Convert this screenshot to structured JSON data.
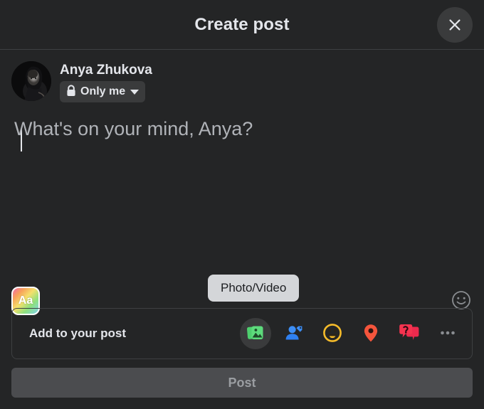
{
  "header": {
    "title": "Create post",
    "close_icon": "close-icon"
  },
  "author": {
    "name": "Anya Zhukova",
    "avatar_alt": "avatar",
    "privacy": {
      "label": "Only me",
      "lock_icon": "lock-icon",
      "chevron_icon": "chevron-down-icon"
    }
  },
  "composer": {
    "placeholder": "What's on your mind, Anya?",
    "value": ""
  },
  "tools": {
    "background_button_label": "Aa",
    "emoji_icon": "smiley-face-icon"
  },
  "add_to_post": {
    "label": "Add to your post",
    "tooltip": "Photo/Video",
    "items": [
      {
        "name": "photo-video",
        "icon": "photo-video-icon",
        "color": "#45bd62",
        "hovered": true
      },
      {
        "name": "tag-people",
        "icon": "tag-people-icon",
        "color": "#1877f2",
        "hovered": false
      },
      {
        "name": "feeling-activity",
        "icon": "feeling-activity-icon",
        "color": "#f7b928",
        "hovered": false
      },
      {
        "name": "check-in",
        "icon": "location-pin-icon",
        "color": "#f5533d",
        "hovered": false
      },
      {
        "name": "ask-for-recommendations",
        "icon": "question-speech-bubble-icon",
        "color": "#f0284a",
        "hovered": false
      },
      {
        "name": "more-options",
        "icon": "ellipsis-icon",
        "color": "#8a8d91",
        "hovered": false
      }
    ]
  },
  "footer": {
    "post_label": "Post",
    "post_enabled": false
  },
  "colors": {
    "dialog_bg": "#242526",
    "page_bg": "#18191a",
    "divider": "#3e4042",
    "text_primary": "#e4e6eb",
    "text_secondary": "#b0b3b8",
    "pill_bg": "#3a3b3c",
    "post_disabled_bg": "#4b4c4f",
    "post_disabled_text": "#9a9da1",
    "tooltip_bg": "#d4d6d9"
  }
}
